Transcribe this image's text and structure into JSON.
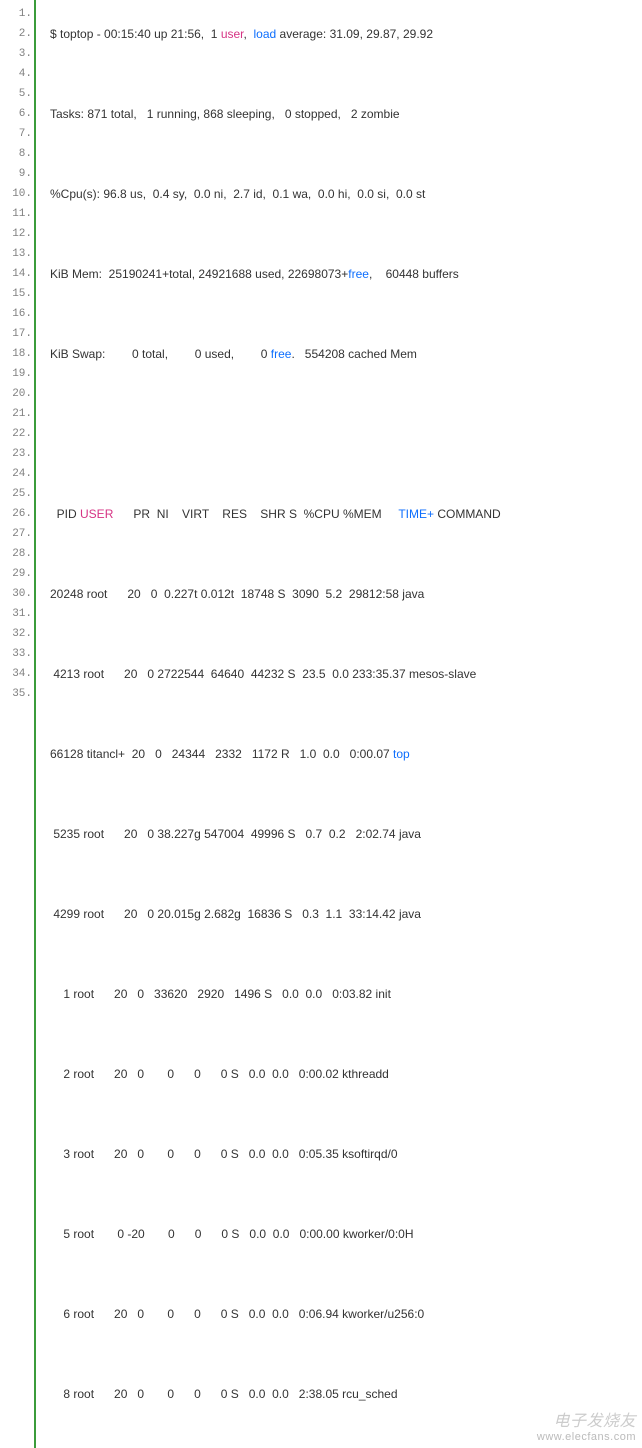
{
  "lineCount": 35,
  "header": {
    "uptime": "$ toptop - 00:15:40 up 21:56,  1 ",
    "userWord": "user",
    "sep1": ",  ",
    "loadWord": "load",
    "loadRest": " average: 31.09, 29.87, 29.92",
    "tasks": "Tasks: 871 total,   1 running, 868 sleeping,   0 stopped,   2 zombie",
    "cpu": "%Cpu(s): 96.8 us,  0.4 sy,  0.0 ni,  2.7 id,  0.1 wa,  0.0 hi,  0.0 si,  0.0 st",
    "memPre": "KiB Mem:  25190241+total, 24921688 used, 22698073+",
    "memFreeWord": "free",
    "memPost": ",    60448 buffers",
    "swapPre": "KiB Swap:        0 total,        0 used,        0 ",
    "swapFreeWord": "free",
    "swapPost": ".   554208 cached Mem"
  },
  "columns": {
    "pre": "  PID ",
    "user": "USER",
    "mid": "      PR  NI    VIRT    RES    SHR S  %CPU %MEM     ",
    "time": "TIME+",
    "post": " COMMAND"
  },
  "rows": {
    "r1": "20248 root      20   0  0.227t 0.012t  18748 S  3090  5.2  29812:58 java",
    "r2": " 4213 root      20   0 2722544  64640  44232 S  23.5  0.0 233:35.37 mesos-slave",
    "r3pre": "66128 titancl+  20   0   24344   2332   1172 R   1.0  0.0   0:00.07 ",
    "r3cmd": "top",
    "r4": " 5235 root      20   0 38.227g 547004  49996 S   0.7  0.2   2:02.74 java",
    "r5": " 4299 root      20   0 20.015g 2.682g  16836 S   0.3  1.1  33:14.42 java",
    "r6": "    1 root      20   0   33620   2920   1496 S   0.0  0.0   0:03.82 init",
    "r7": "    2 root      20   0       0      0      0 S   0.0  0.0   0:00.02 kthreadd",
    "r8": "    3 root      20   0       0      0      0 S   0.0  0.0   0:05.35 ksoftirqd/0",
    "r9": "    5 root       0 -20       0      0      0 S   0.0  0.0   0:00.00 kworker/0:0H",
    "r10": "    6 root      20   0       0      0      0 S   0.0  0.0   0:06.94 kworker/u256:0",
    "r11": "    8 root      20   0       0      0      0 S   0.0  0.0   2:38.05 rcu_sched"
  },
  "watermark": {
    "brand": "电子发烧友",
    "url": "www.elecfans.com"
  },
  "chart_data": {
    "type": "table",
    "title": "top output",
    "uptime": "00:15:40 up 21:56",
    "users": 1,
    "load_avg": [
      31.09,
      29.87,
      29.92
    ],
    "tasks": {
      "total": 871,
      "running": 1,
      "sleeping": 868,
      "stopped": 0,
      "zombie": 2
    },
    "cpu_pct": {
      "us": 96.8,
      "sy": 0.4,
      "ni": 0.0,
      "id": 2.7,
      "wa": 0.1,
      "hi": 0.0,
      "si": 0.0,
      "st": 0.0
    },
    "mem_kib": {
      "total": "25190241+",
      "used": 24921688,
      "free": "22698073+",
      "buffers": 60448
    },
    "swap_kib": {
      "total": 0,
      "used": 0,
      "free": 0,
      "cached": 554208
    },
    "columns": [
      "PID",
      "USER",
      "PR",
      "NI",
      "VIRT",
      "RES",
      "SHR",
      "S",
      "%CPU",
      "%MEM",
      "TIME+",
      "COMMAND"
    ],
    "processes": [
      {
        "PID": 20248,
        "USER": "root",
        "PR": 20,
        "NI": 0,
        "VIRT": "0.227t",
        "RES": "0.012t",
        "SHR": 18748,
        "S": "S",
        "CPU": 3090,
        "MEM": 5.2,
        "TIME": "29812:58",
        "COMMAND": "java"
      },
      {
        "PID": 4213,
        "USER": "root",
        "PR": 20,
        "NI": 0,
        "VIRT": 2722544,
        "RES": 64640,
        "SHR": 44232,
        "S": "S",
        "CPU": 23.5,
        "MEM": 0.0,
        "TIME": "233:35.37",
        "COMMAND": "mesos-slave"
      },
      {
        "PID": 66128,
        "USER": "titancl+",
        "PR": 20,
        "NI": 0,
        "VIRT": 24344,
        "RES": 2332,
        "SHR": 1172,
        "S": "R",
        "CPU": 1.0,
        "MEM": 0.0,
        "TIME": "0:00.07",
        "COMMAND": "top"
      },
      {
        "PID": 5235,
        "USER": "root",
        "PR": 20,
        "NI": 0,
        "VIRT": "38.227g",
        "RES": 547004,
        "SHR": 49996,
        "S": "S",
        "CPU": 0.7,
        "MEM": 0.2,
        "TIME": "2:02.74",
        "COMMAND": "java"
      },
      {
        "PID": 4299,
        "USER": "root",
        "PR": 20,
        "NI": 0,
        "VIRT": "20.015g",
        "RES": "2.682g",
        "SHR": 16836,
        "S": "S",
        "CPU": 0.3,
        "MEM": 1.1,
        "TIME": "33:14.42",
        "COMMAND": "java"
      },
      {
        "PID": 1,
        "USER": "root",
        "PR": 20,
        "NI": 0,
        "VIRT": 33620,
        "RES": 2920,
        "SHR": 1496,
        "S": "S",
        "CPU": 0.0,
        "MEM": 0.0,
        "TIME": "0:03.82",
        "COMMAND": "init"
      },
      {
        "PID": 2,
        "USER": "root",
        "PR": 20,
        "NI": 0,
        "VIRT": 0,
        "RES": 0,
        "SHR": 0,
        "S": "S",
        "CPU": 0.0,
        "MEM": 0.0,
        "TIME": "0:00.02",
        "COMMAND": "kthreadd"
      },
      {
        "PID": 3,
        "USER": "root",
        "PR": 20,
        "NI": 0,
        "VIRT": 0,
        "RES": 0,
        "SHR": 0,
        "S": "S",
        "CPU": 0.0,
        "MEM": 0.0,
        "TIME": "0:05.35",
        "COMMAND": "ksoftirqd/0"
      },
      {
        "PID": 5,
        "USER": "root",
        "PR": 0,
        "NI": -20,
        "VIRT": 0,
        "RES": 0,
        "SHR": 0,
        "S": "S",
        "CPU": 0.0,
        "MEM": 0.0,
        "TIME": "0:00.00",
        "COMMAND": "kworker/0:0H"
      },
      {
        "PID": 6,
        "USER": "root",
        "PR": 20,
        "NI": 0,
        "VIRT": 0,
        "RES": 0,
        "SHR": 0,
        "S": "S",
        "CPU": 0.0,
        "MEM": 0.0,
        "TIME": "0:06.94",
        "COMMAND": "kworker/u256:0"
      },
      {
        "PID": 8,
        "USER": "root",
        "PR": 20,
        "NI": 0,
        "VIRT": 0,
        "RES": 0,
        "SHR": 0,
        "S": "S",
        "CPU": 0.0,
        "MEM": 0.0,
        "TIME": "2:38.05",
        "COMMAND": "rcu_sched"
      }
    ]
  }
}
